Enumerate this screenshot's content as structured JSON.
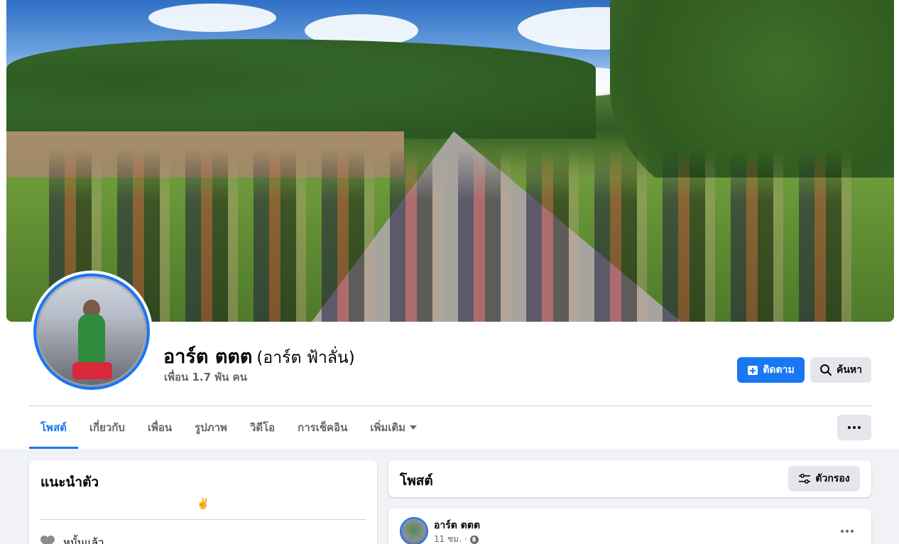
{
  "profile": {
    "name": "อาร์ต ตตต",
    "alternate_name": "(อาร์ต ฟ้าลั่น)",
    "friends_text": "เพื่อน 1.7 พัน คน"
  },
  "actions": {
    "follow_label": "ติดตาม",
    "search_label": "ค้นหา"
  },
  "tabs": [
    {
      "label": "โพสต์",
      "active": true
    },
    {
      "label": "เกี่ยวกับ"
    },
    {
      "label": "เพื่อน"
    },
    {
      "label": "รูปภาพ"
    },
    {
      "label": "วิดีโอ"
    },
    {
      "label": "การเช็คอิน"
    },
    {
      "label": "เพิ่มเติม"
    }
  ],
  "intro": {
    "title": "แนะนำตัว",
    "bio": "✌️",
    "relationship": "หมั้นแล้ว"
  },
  "posts": {
    "title": "โพสต์",
    "filter_label": "ตัวกรอง"
  },
  "post": {
    "author": "อาร์ต ตตต",
    "time": "11 ชม. ·"
  },
  "colors": {
    "accent": "#1877f2",
    "page_bg": "#f0f2f5",
    "secondary_button": "#e4e6eb",
    "muted_text": "#65676b"
  }
}
